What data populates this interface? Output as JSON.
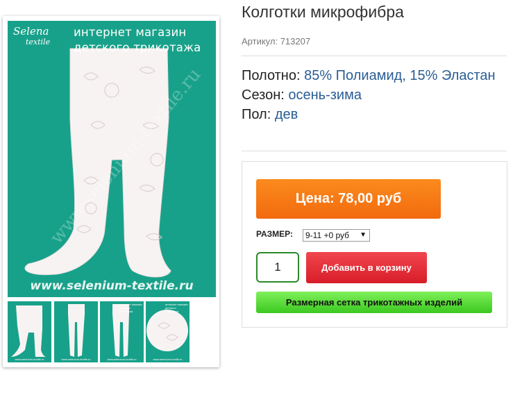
{
  "product": {
    "title": "Колготки микрофибра",
    "sku_label": "Артикул:",
    "sku_value": "713207"
  },
  "props": [
    {
      "label": "Полотно:",
      "value": "85% Полиамид, 15% Эластан"
    },
    {
      "label": "Сезон:",
      "value": "осень-зима"
    },
    {
      "label": "Пол:",
      "value": "дев"
    }
  ],
  "buy": {
    "price_label": "Цена: 78,00 руб",
    "size_label": "РАЗМЕР:",
    "size_selected": "9-11 +0 руб",
    "quantity": "1",
    "add_to_cart": "Добавить в корзину",
    "size_chart": "Размерная сетка трикотажных изделий"
  },
  "image": {
    "brand_line1": "Selena",
    "brand_line2": "textile",
    "shop_line1": "интернет магазин",
    "shop_line2": "детского трикотажа",
    "watermark": "www.selenium-textile.ru",
    "url": "www.selenium-textile.ru",
    "thumb_caption": "www.selenium-textile.ru",
    "thumb_top": "интернет магазин детского трикотажа"
  },
  "colors": {
    "image_bg": "#18a18a",
    "price_orange": "#f26a0e",
    "cart_red": "#d81d28",
    "grid_green": "#3cc820",
    "value_blue": "#2a5d94"
  }
}
